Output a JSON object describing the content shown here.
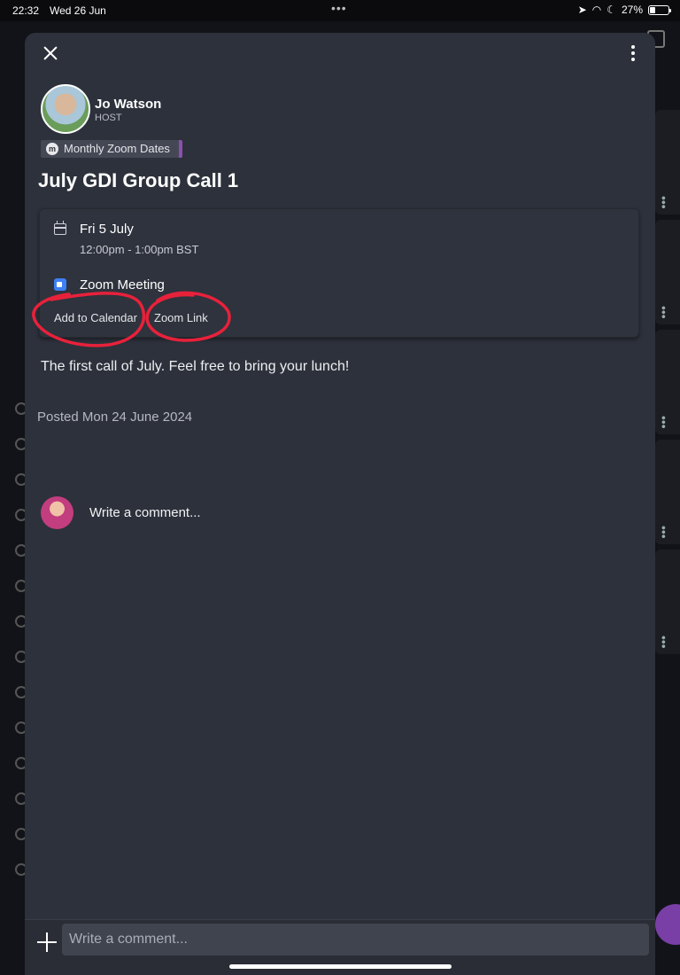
{
  "status_bar": {
    "time": "22:32",
    "date": "Wed 26 Jun",
    "battery": "27%"
  },
  "event": {
    "host": {
      "name": "Jo Watson",
      "role": "HOST"
    },
    "group_chip": {
      "icon_letter": "m",
      "label": "Monthly Zoom Dates"
    },
    "title": "July GDI Group Call 1",
    "date": "Fri 5 July",
    "time_range": "12:00pm - 1:00pm BST",
    "location": "Zoom Meeting",
    "actions": {
      "add_to_calendar": "Add to Calendar",
      "zoom_link": "Zoom Link"
    },
    "description": "The first call of July. Feel free to bring your lunch!",
    "posted": "Posted Mon 24 June 2024"
  },
  "comments": {
    "prompt": "Write a comment...",
    "input_placeholder": "Write a comment..."
  },
  "colors": {
    "modal_bg": "#2d313b",
    "chip_accent": "#8b4fb0",
    "annotation_red": "#e8213b",
    "zoom_blue": "#3d7ff6"
  },
  "icons": [
    "close-icon",
    "more-vertical-icon",
    "calendar-icon",
    "zoom-icon",
    "plus-icon",
    "battery-icon"
  ]
}
